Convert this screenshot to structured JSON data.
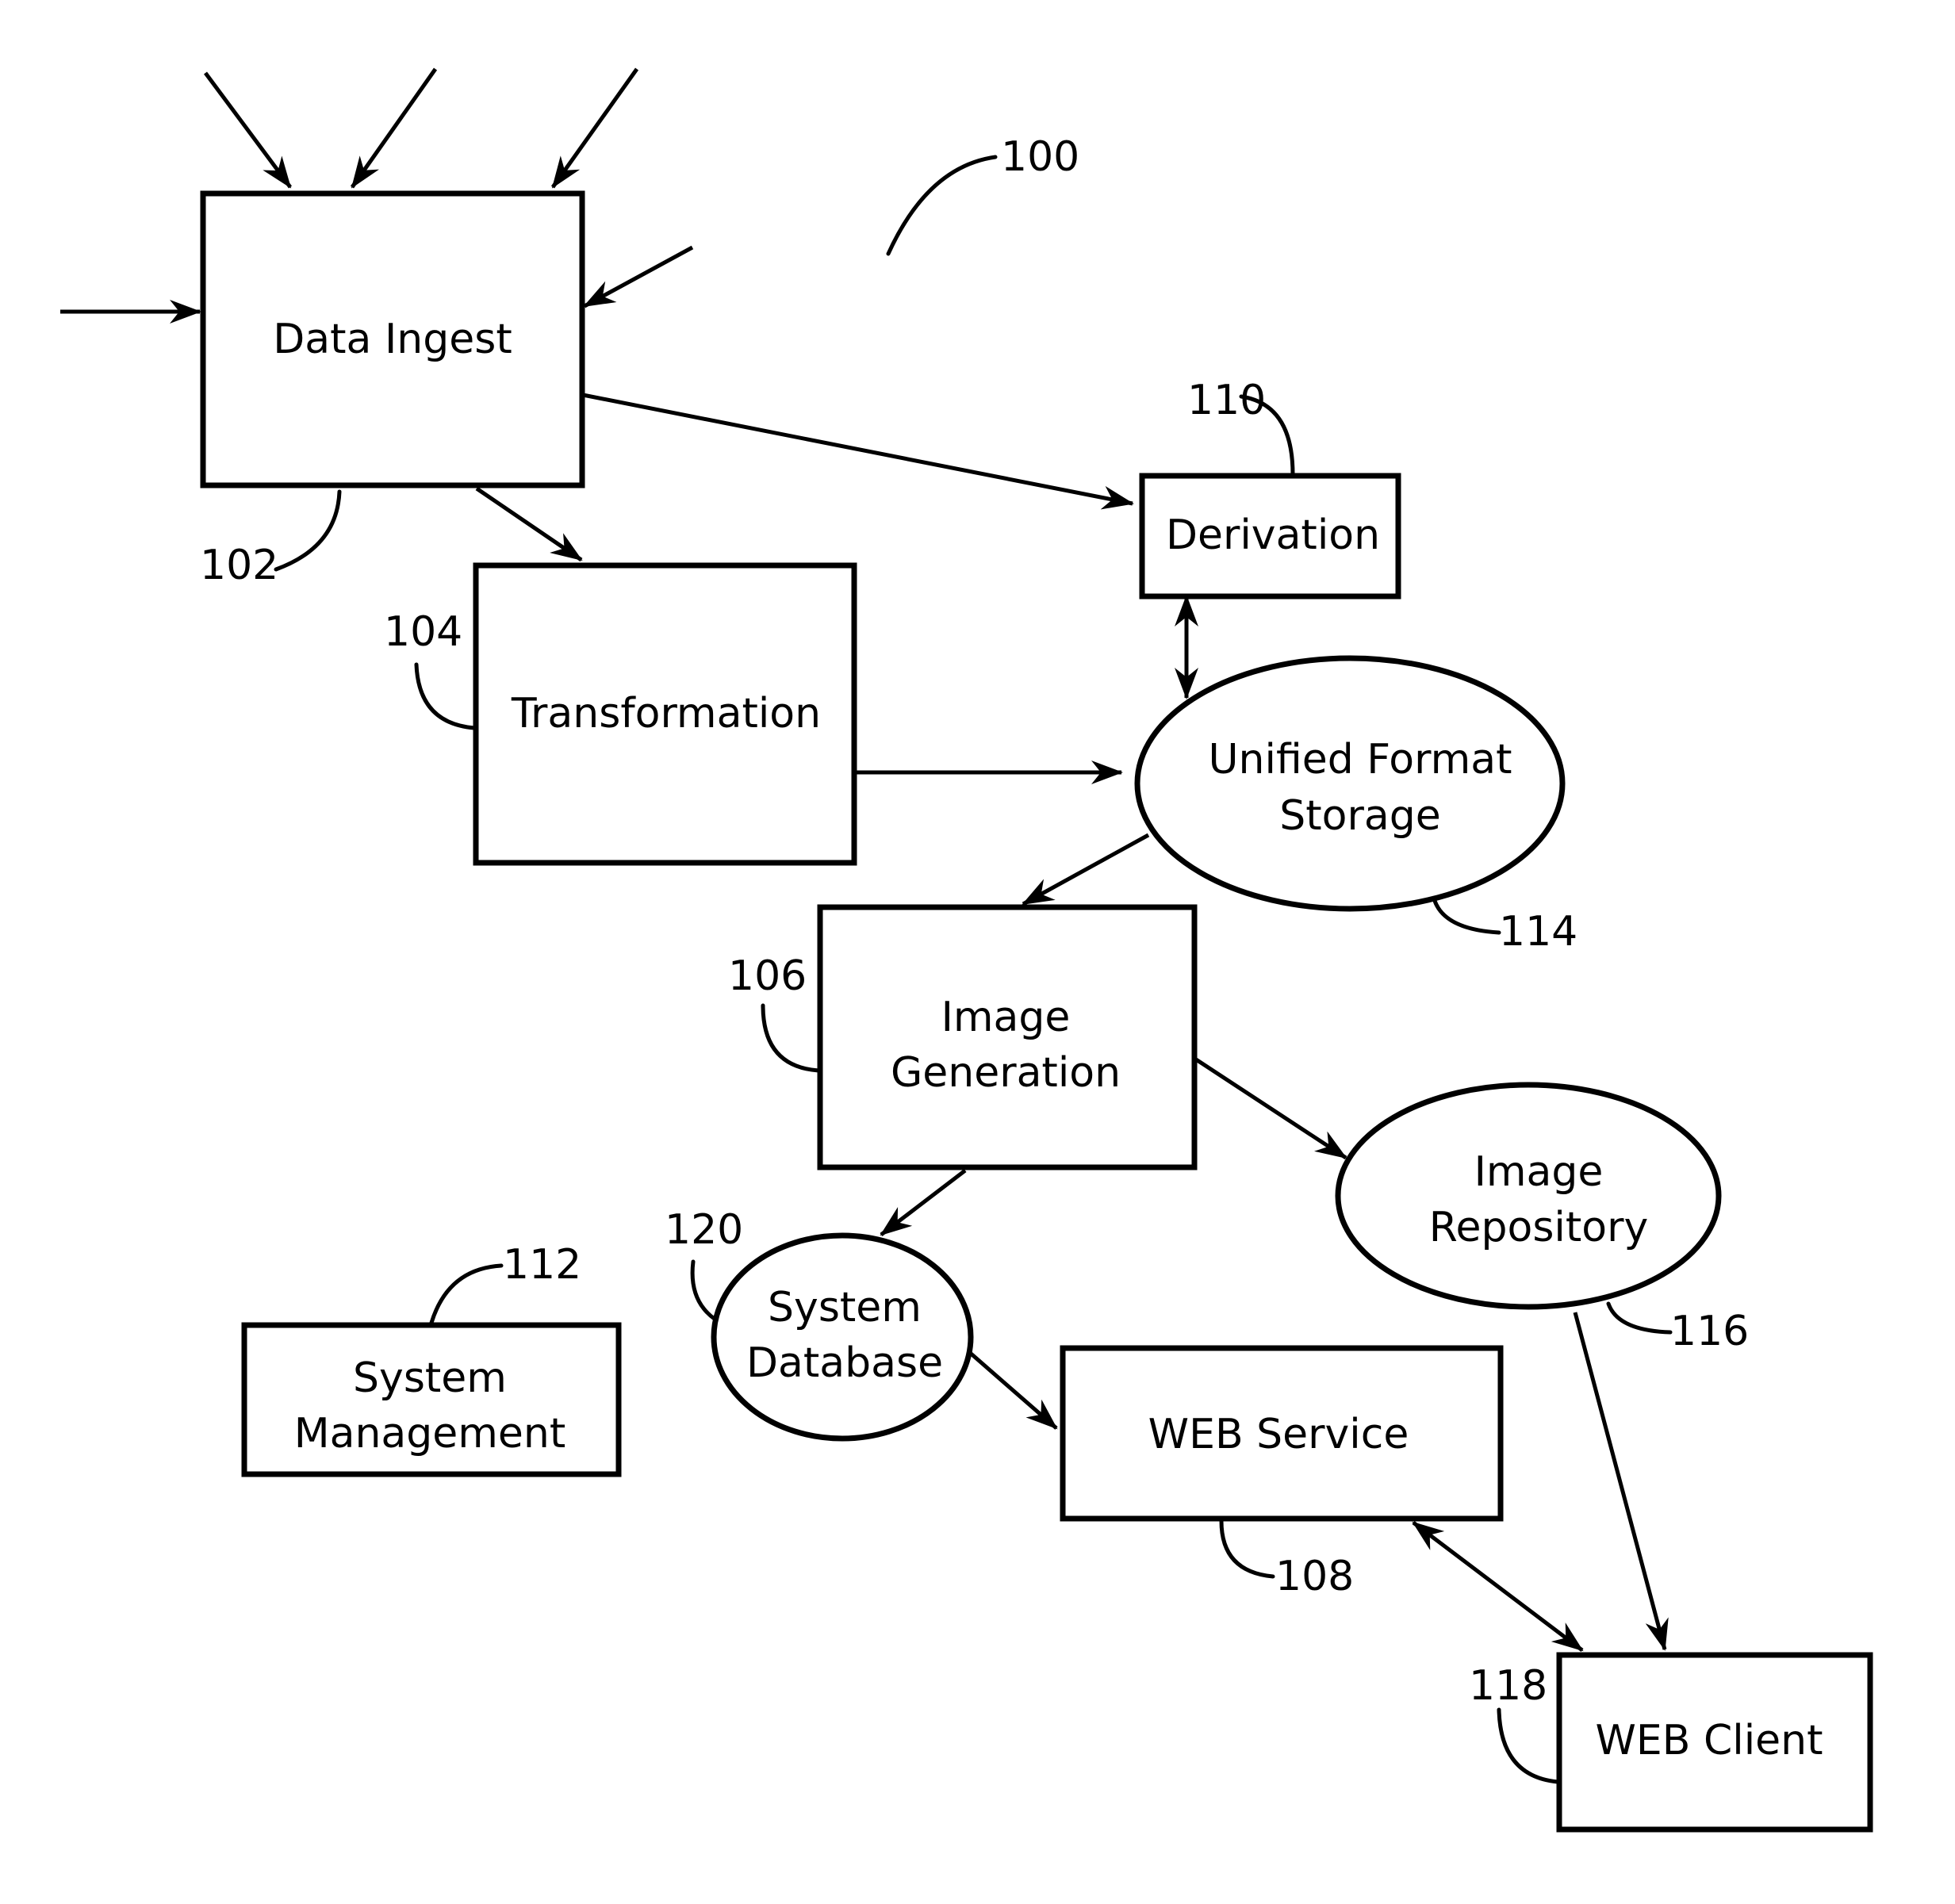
{
  "figure": {
    "reference": "100",
    "nodes": {
      "data_ingest": {
        "label": "Data Ingest",
        "ref": "102",
        "shape": "rectangle"
      },
      "transformation": {
        "label": "Transformation",
        "ref": "104",
        "shape": "rectangle"
      },
      "derivation": {
        "label": "Derivation",
        "ref": "110",
        "shape": "rectangle"
      },
      "unified_format_storage": {
        "label_line1": "Unified Format",
        "label_line2": "Storage",
        "ref": "114",
        "shape": "ellipse"
      },
      "image_generation": {
        "label_line1": "Image",
        "label_line2": "Generation",
        "ref": "106",
        "shape": "rectangle"
      },
      "image_repository": {
        "label_line1": "Image",
        "label_line2": "Repository",
        "ref": "116",
        "shape": "ellipse"
      },
      "system_database": {
        "label_line1": "System",
        "label_line2": "Database",
        "ref": "120",
        "shape": "ellipse"
      },
      "system_management": {
        "label_line1": "System",
        "label_line2": "Management",
        "ref": "112",
        "shape": "rectangle"
      },
      "web_service": {
        "label": "WEB Service",
        "ref": "108",
        "shape": "rectangle"
      },
      "web_client": {
        "label": "WEB Client",
        "ref": "118",
        "shape": "rectangle"
      }
    },
    "edges": [
      {
        "from": "external-input-1",
        "to": "Data Ingest",
        "direction": "one-way"
      },
      {
        "from": "external-input-2",
        "to": "Data Ingest",
        "direction": "one-way"
      },
      {
        "from": "external-input-3",
        "to": "Data Ingest",
        "direction": "one-way"
      },
      {
        "from": "external-input-4",
        "to": "Data Ingest",
        "direction": "one-way"
      },
      {
        "from": "external-input-5",
        "to": "Data Ingest",
        "direction": "one-way"
      },
      {
        "from": "Data Ingest",
        "to": "Derivation",
        "direction": "one-way"
      },
      {
        "from": "Data Ingest",
        "to": "Transformation",
        "direction": "one-way"
      },
      {
        "from": "Transformation",
        "to": "Unified Format Storage",
        "direction": "one-way"
      },
      {
        "from": "Derivation",
        "to": "Unified Format Storage",
        "direction": "two-way"
      },
      {
        "from": "Unified Format Storage",
        "to": "Image Generation",
        "direction": "one-way"
      },
      {
        "from": "Image Generation",
        "to": "Image Repository",
        "direction": "one-way"
      },
      {
        "from": "Image Generation",
        "to": "System Database",
        "direction": "one-way"
      },
      {
        "from": "System Database",
        "to": "WEB Service",
        "direction": "one-way"
      },
      {
        "from": "Image Repository",
        "to": "WEB Client",
        "direction": "one-way"
      },
      {
        "from": "WEB Service",
        "to": "WEB Client",
        "direction": "two-way"
      }
    ]
  }
}
